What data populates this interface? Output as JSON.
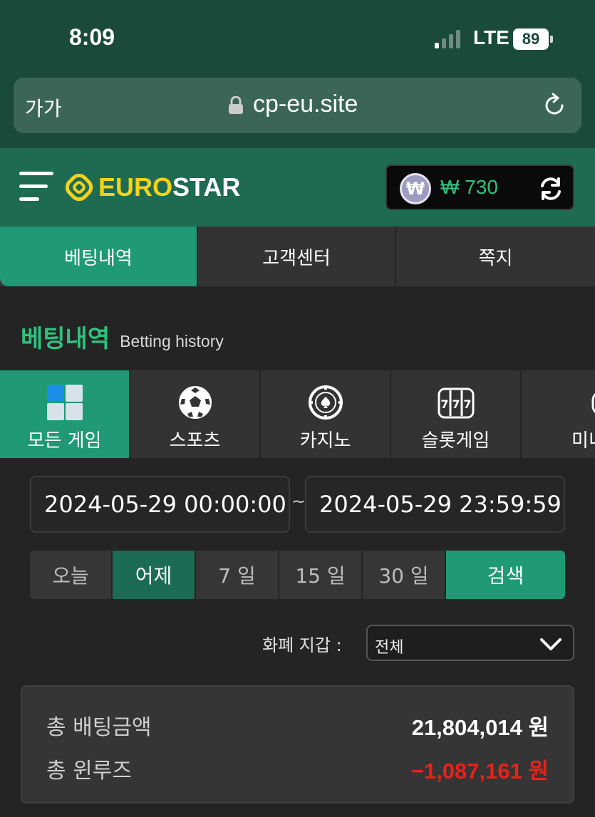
{
  "status_bar": {
    "time": "8:09",
    "network": "LTE",
    "battery": "89"
  },
  "browser": {
    "text_size_label": "가가",
    "url": "cp-eu.site"
  },
  "header": {
    "logo_text_yellow": "EURO",
    "logo_text_white": "STAR",
    "currency_symbol": "₩",
    "balance": "₩ 730"
  },
  "top_tabs": [
    {
      "label": "베팅내역",
      "active": true
    },
    {
      "label": "고객센터",
      "active": false
    },
    {
      "label": "쪽지",
      "active": false
    }
  ],
  "section": {
    "title": "베팅내역",
    "subtitle": "Betting history"
  },
  "categories": [
    {
      "label": "모든 게임",
      "icon": "all-games-icon",
      "active": true
    },
    {
      "label": "스포츠",
      "icon": "soccer-ball-icon",
      "active": false
    },
    {
      "label": "카지노",
      "icon": "casino-chip-icon",
      "active": false
    },
    {
      "label": "슬롯게임",
      "icon": "slot-machine-icon",
      "active": false
    },
    {
      "label": "미니",
      "icon": "gamepad-icon",
      "active": false
    }
  ],
  "date_range": {
    "start": "2024-05-29 00:00:00",
    "separator": "~",
    "end": "2024-05-29 23:59:59"
  },
  "quick_ranges": [
    {
      "label": "오늘",
      "active": false
    },
    {
      "label": "어제",
      "active": true
    },
    {
      "label": "7 일",
      "active": false
    },
    {
      "label": "15 일",
      "active": false
    },
    {
      "label": "30 일",
      "active": false
    }
  ],
  "search_label": "검색",
  "wallet": {
    "label": "화폐 지갑 :",
    "selected": "전체"
  },
  "summary": {
    "total_bet_label": "총 배팅금액",
    "total_bet_value": "21,804,014 원",
    "total_winloss_label": "총 윈루즈",
    "total_winloss_value": "−1,087,161 원"
  },
  "colors": {
    "accent": "#1f9a74",
    "header_bg": "#1e6b52",
    "negative": "#e8211b",
    "logo_yellow": "#f5d21a"
  }
}
